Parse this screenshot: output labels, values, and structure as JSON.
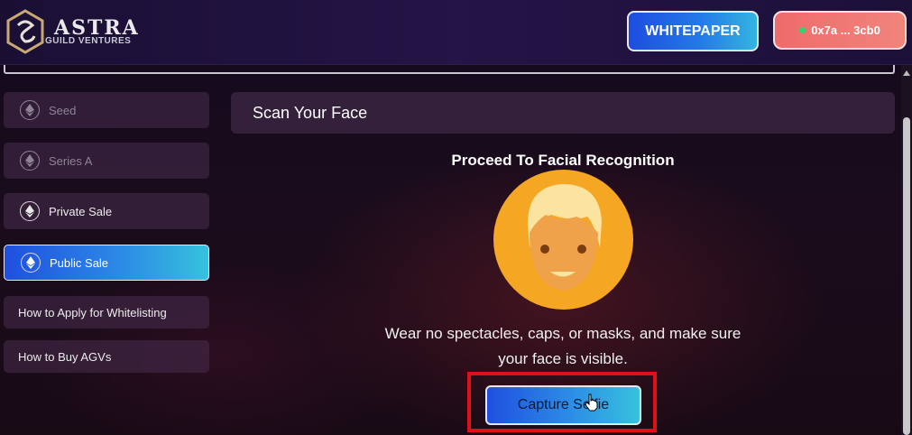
{
  "header": {
    "brand_title": "ASTRA",
    "brand_subtitle": "GUILD VENTURES",
    "whitepaper_label": "WHITEPAPER",
    "wallet_label": "0x7a ... 3cb0",
    "wallet_status_color": "#2dd36f"
  },
  "sidebar": {
    "items": [
      {
        "label": "Seed",
        "icon": "ethereum-icon",
        "state": "disabled"
      },
      {
        "label": "Series A",
        "icon": "ethereum-icon",
        "state": "disabled"
      },
      {
        "label": "Private Sale",
        "icon": "ethereum-icon",
        "state": "normal"
      },
      {
        "label": "Public Sale",
        "icon": "ethereum-icon",
        "state": "active"
      },
      {
        "label": "How to Apply for Whitelisting",
        "state": "normal"
      },
      {
        "label": "How to Buy AGVs",
        "state": "normal"
      }
    ]
  },
  "main": {
    "panel_title": "Scan Your Face",
    "heading": "Proceed To Facial Recognition",
    "face_icon": "face-avatar-icon",
    "instruction_line1": "Wear no spectacles, caps, or masks, and make sure",
    "instruction_line2": "your face is visible.",
    "capture_label": "Capture Selfie"
  },
  "colors": {
    "accent_gradient_start": "#1f4fe0",
    "accent_gradient_end": "#36c2dc",
    "highlight": "#e0101a",
    "wallet_button": "#ef6b6b"
  }
}
